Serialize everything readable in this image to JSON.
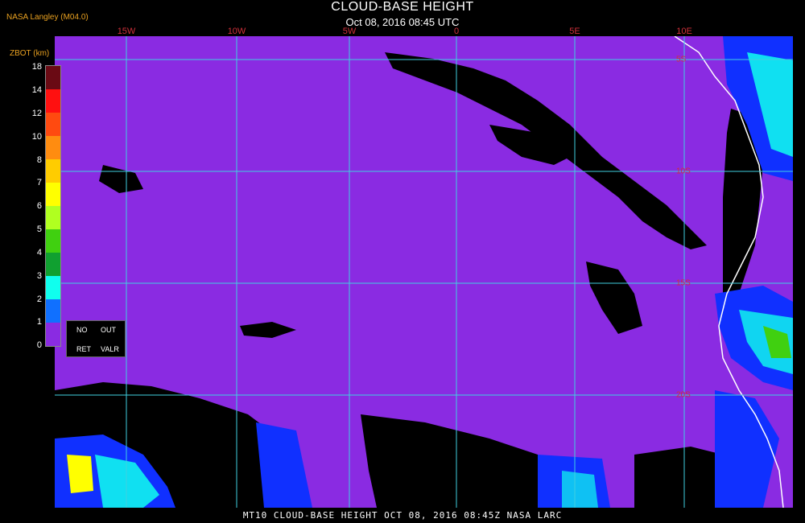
{
  "header": {
    "title": "CLOUD-BASE HEIGHT",
    "subtitle": "Oct 08, 2016 08:45 UTC",
    "provider": "NASA Langley (M04.0)"
  },
  "map": {
    "lon_labels": [
      "15W",
      "10W",
      "5W",
      "0",
      "5E",
      "10E"
    ],
    "lat_labels": [
      "5S",
      "10S",
      "15S",
      "20S"
    ],
    "colors": {
      "background": "#8a2be2",
      "clear": "#000000",
      "grid": "#3fd0e0",
      "coast": "#ffffff"
    }
  },
  "legend": {
    "title": "ZBOT (km)",
    "ticks": [
      "18",
      "14",
      "12",
      "10",
      "8",
      "7",
      "6",
      "5",
      "4",
      "3",
      "2",
      "1",
      "0"
    ],
    "colors": [
      "#6a0a14",
      "#ff1010",
      "#ff4a10",
      "#ff8c10",
      "#ffcc00",
      "#ffff00",
      "#b0ff20",
      "#40d010",
      "#10a030",
      "#10ffee",
      "#1070ff",
      "#0010ff",
      "#8a2be2"
    ],
    "no_label_1": "NO",
    "no_label_2": "RET",
    "out_label_1": "OUT",
    "out_label_2": "VALR"
  },
  "footer": {
    "text": "MT10  CLOUD-BASE HEIGHT  OCT 08, 2016 08:45Z  NASA LARC"
  }
}
